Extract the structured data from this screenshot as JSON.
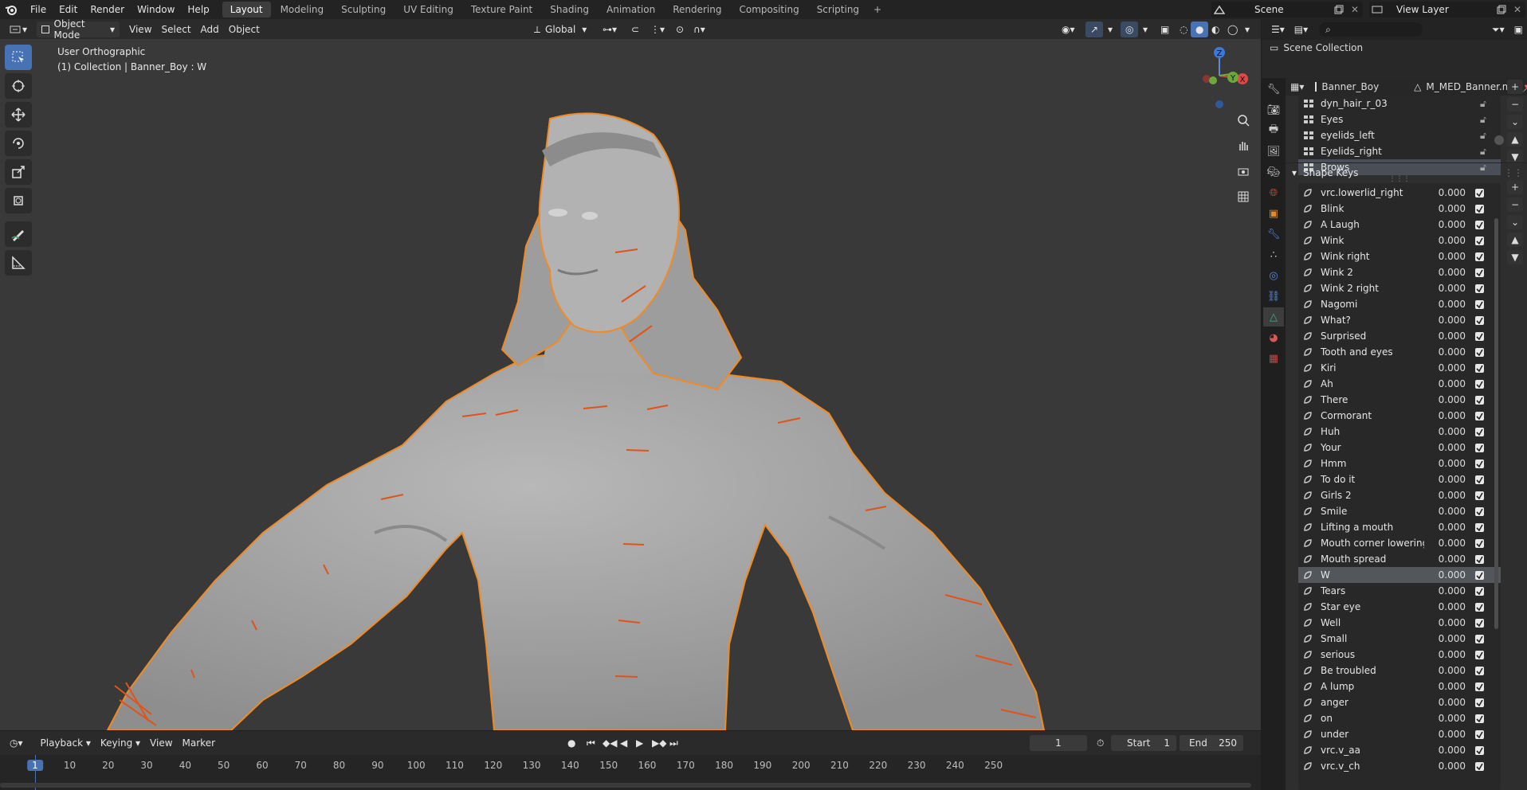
{
  "app": {
    "title": "Blender"
  },
  "menu": {
    "file": "File",
    "edit": "Edit",
    "render": "Render",
    "window": "Window",
    "help": "Help"
  },
  "workspaces": [
    "Layout",
    "Modeling",
    "Sculpting",
    "UV Editing",
    "Texture Paint",
    "Shading",
    "Animation",
    "Rendering",
    "Compositing",
    "Scripting"
  ],
  "active_workspace": "Layout",
  "scene": {
    "label": "Scene",
    "view_layer": "View Layer"
  },
  "viewport_header": {
    "mode": "Object Mode",
    "view": "View",
    "select": "Select",
    "add": "Add",
    "object": "Object",
    "orientation": "Global"
  },
  "viewport": {
    "view_name": "User Orthographic",
    "collection_info": "(1) Collection | Banner_Boy : W"
  },
  "gizmo": {
    "z": "Z",
    "x": "X",
    "y": "Y"
  },
  "timeline": {
    "playback": "Playback",
    "keying": "Keying",
    "view": "View",
    "marker": "Marker",
    "current_frame": "1",
    "start_label": "Start",
    "start": "1",
    "end_label": "End",
    "end": "250",
    "ticks": [
      "1",
      "10",
      "20",
      "30",
      "40",
      "50",
      "60",
      "70",
      "80",
      "90",
      "100",
      "110",
      "120",
      "130",
      "140",
      "150",
      "160",
      "170",
      "180",
      "190",
      "200",
      "210",
      "220",
      "230",
      "240",
      "250"
    ]
  },
  "outliner": {
    "scene_collection": "Scene Collection"
  },
  "properties": {
    "object": "Banner_Boy",
    "mesh": "M_MED_Banner.md",
    "vertex_groups": [
      {
        "name": "dyn_hair_r_03",
        "selected": false
      },
      {
        "name": "Eyes",
        "selected": false
      },
      {
        "name": "eyelids_left",
        "selected": false
      },
      {
        "name": "Eyelids_right",
        "selected": false
      },
      {
        "name": "Brows",
        "selected": true
      }
    ],
    "shape_keys_title": "Shape Keys",
    "shape_keys": [
      {
        "name": "vrc.lowerlid_right",
        "value": "0.000"
      },
      {
        "name": "Blink",
        "value": "0.000"
      },
      {
        "name": "A Laugh",
        "value": "0.000"
      },
      {
        "name": "Wink",
        "value": "0.000"
      },
      {
        "name": "Wink right",
        "value": "0.000"
      },
      {
        "name": "Wink 2",
        "value": "0.000"
      },
      {
        "name": "Wink 2 right",
        "value": "0.000"
      },
      {
        "name": "Nagomi",
        "value": "0.000"
      },
      {
        "name": "What?",
        "value": "0.000"
      },
      {
        "name": "Surprised",
        "value": "0.000"
      },
      {
        "name": "Tooth and eyes",
        "value": "0.000"
      },
      {
        "name": "Kiri",
        "value": "0.000"
      },
      {
        "name": "Ah",
        "value": "0.000"
      },
      {
        "name": "There",
        "value": "0.000"
      },
      {
        "name": "Cormorant",
        "value": "0.000"
      },
      {
        "name": "Huh",
        "value": "0.000"
      },
      {
        "name": "Your",
        "value": "0.000"
      },
      {
        "name": "Hmm",
        "value": "0.000"
      },
      {
        "name": "To do it",
        "value": "0.000"
      },
      {
        "name": "Girls 2",
        "value": "0.000"
      },
      {
        "name": "Smile",
        "value": "0.000"
      },
      {
        "name": "Lifting a mouth",
        "value": "0.000"
      },
      {
        "name": "Mouth corner lowering",
        "value": "0.000"
      },
      {
        "name": "Mouth spread",
        "value": "0.000"
      },
      {
        "name": "W",
        "value": "0.000",
        "selected": true
      },
      {
        "name": "Tears",
        "value": "0.000"
      },
      {
        "name": "Star eye",
        "value": "0.000"
      },
      {
        "name": "Well",
        "value": "0.000"
      },
      {
        "name": "Small",
        "value": "0.000"
      },
      {
        "name": "serious",
        "value": "0.000"
      },
      {
        "name": "Be troubled",
        "value": "0.000"
      },
      {
        "name": "A lump",
        "value": "0.000"
      },
      {
        "name": "anger",
        "value": "0.000"
      },
      {
        "name": "on",
        "value": "0.000"
      },
      {
        "name": "under",
        "value": "0.000"
      },
      {
        "name": "vrc.v_aa",
        "value": "0.000"
      },
      {
        "name": "vrc.v_ch",
        "value": "0.000"
      }
    ]
  },
  "colors": {
    "accent": "#4772b3",
    "selection_outline": "#f08a24",
    "bone": "#e0541a"
  }
}
